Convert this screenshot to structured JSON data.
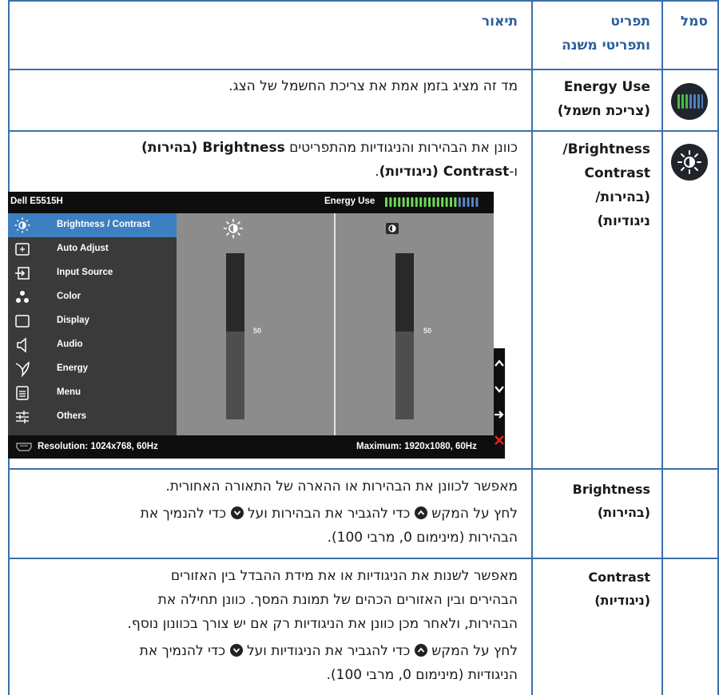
{
  "header": {
    "icon_col": "סמל",
    "menu_col_line1": "תפריט",
    "menu_col_line2": "ותפריטי משנה",
    "desc_col": "תיאור"
  },
  "rows": [
    {
      "term_line1": "Energy Use",
      "term_line2": "(צריכת חשמל)",
      "desc": "מד זה מציג בזמן אמת את צריכת החשמל של הצג."
    },
    {
      "term_line1": "Brightness/",
      "term_line2": "Contrast",
      "term_line3": "(בהירות/",
      "term_line4": "ניגודיות)",
      "desc_line1_pre": "כוונן את הבהירות והניגודיות מהתפריטים ",
      "desc_line1_bold": "Brightness (בהירות)",
      "desc_line2_pre": "ו-",
      "desc_line2_bold": "Contrast (ניגודיות)",
      "desc_line2_post": "."
    },
    {
      "term_line1": "Brightness",
      "term_line2": "(בהירות)",
      "desc_p1": "מאפשר לכוונן את הבהירות או ההארה של התאורה האחורית.",
      "desc_p2_a": "לחץ על המקש",
      "desc_p2_b": "כדי להגביר את הבהירות ועל",
      "desc_p2_c": "כדי להנמיך את",
      "desc_p2_line2": "הבהירות (מינימום 0, מרבי 100)."
    },
    {
      "term_line1": "Contrast",
      "term_line2": "(ניגודיות)",
      "desc_p1_line1": "מאפשר לשנות את הניגודיות או את מידת ההבדל בין האזורים",
      "desc_p1_line2": "הבהירים ובין האזורים הכהים של תמונת המסך. כוונן תחילה את",
      "desc_p1_line3": "הבהירות, ולאחר מכן כוונן את הניגודיות רק אם יש צורך בכוונון נוסף.",
      "desc_p2_a": "לחץ על המקש",
      "desc_p2_b": "כדי להגביר את הניגודיות ועל",
      "desc_p2_c": "כדי להנמיך את",
      "desc_p2_line2": "הניגודיות (מינימום 0, מרבי 100)."
    }
  ],
  "osd": {
    "model": "Dell E5515H",
    "energy_label": "Energy Use",
    "energy_level_fraction": 0.75,
    "menu_items": [
      {
        "label": "Brightness / Contrast",
        "icon": "sun-icon",
        "active": true
      },
      {
        "label": "Auto Adjust",
        "icon": "auto-adjust-icon",
        "active": false
      },
      {
        "label": "Input Source",
        "icon": "input-source-icon",
        "active": false
      },
      {
        "label": "Color",
        "icon": "color-dots-icon",
        "active": false
      },
      {
        "label": "Display",
        "icon": "display-icon",
        "active": false
      },
      {
        "label": "Audio",
        "icon": "speaker-icon",
        "active": false
      },
      {
        "label": "Energy",
        "icon": "leaf-icon",
        "active": false
      },
      {
        "label": "Menu",
        "icon": "menu-doc-icon",
        "active": false
      },
      {
        "label": "Others",
        "icon": "sliders-icon",
        "active": false
      }
    ],
    "brightness_value": "50",
    "contrast_value": "50",
    "brightness_fraction": 0.5,
    "contrast_fraction": 0.5,
    "resolution": "Resolution: 1024x768, 60Hz",
    "maximum": "Maximum: 1920x1080, 60Hz",
    "accent_color": "#3d7fc1",
    "close_color": "#e8241c"
  },
  "colors": {
    "border": "#3c6fa8",
    "header_text": "#2b5f9e"
  }
}
